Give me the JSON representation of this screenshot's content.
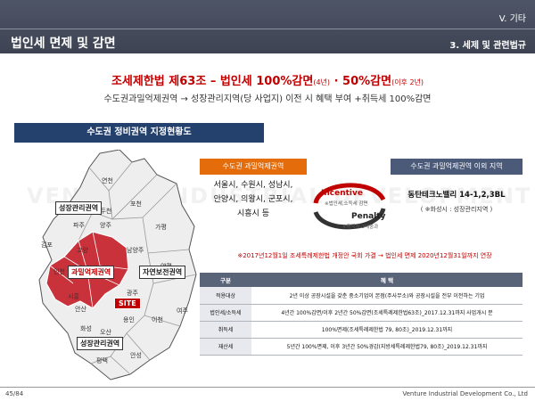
{
  "header": {
    "section": "V. 기타",
    "title": "법인세 면제 및 감면",
    "subtitle": "3. 세제 및 관련법규"
  },
  "headline": {
    "part1": "조세제한법 제63조 – 법인세 100%감면",
    "small1": "(4년)",
    "part2": " · 50%감면",
    "small2": "(이후 2년)"
  },
  "subline": "수도권과밀억제권역 → 성장관리지역(당 사업지) 이전 시 혜택 부여 +취득세 100%감면",
  "map": {
    "banner": "수도권 정비권역 지정현황도",
    "tags": {
      "growth_top": "성장관리권역",
      "overcrowded": "과밀억제권역",
      "conservation": "자연보전권역",
      "growth_bottom": "성장관리권역",
      "site": "SITE"
    },
    "places": [
      "연천",
      "포천",
      "파주",
      "양주",
      "동두천",
      "가평",
      "김포",
      "고양",
      "남양주",
      "양평",
      "인천",
      "시흥",
      "안산",
      "화성",
      "오산",
      "용인",
      "이천",
      "여주",
      "평택",
      "안성",
      "광주"
    ]
  },
  "left_panel": {
    "header": "수도권 과밀억제권역",
    "lines": [
      "서울시, 수원시, 성남시,",
      "안양시, 의왕시, 군포시,",
      "시흥시 등"
    ]
  },
  "right_panel": {
    "header": "수도권 과밀억제권역 이외 지역",
    "main": "동탄테크노밸리 14-1,2,3BL",
    "note": "( ※화성시 : 성장관리지역 )"
  },
  "cycle": {
    "incentive": "Incentive",
    "incentive_note": "※법인세,소득세 감면",
    "penalty": "Penalty",
    "penalty_note": "※취득세 3배중과"
  },
  "notice": "※2017년12월1일 조세특례제한법 개정안 국회 가결 → 법인세 면제 2020년12월31일까지 연장",
  "table": {
    "headers": [
      "구분",
      "혜 택"
    ],
    "rows": [
      {
        "cat": "적용대상",
        "text": "2년 이상 공장시설을 갖춘 중소기업이 본점(주사무소)와 공장시설을 전부 이전하는 기업"
      },
      {
        "cat": "법인세/소득세",
        "text": "4년간 100%감면/이후 2년간 50%감면(조세특례제한법63조)_2017.12.31까지 사업개시 분"
      },
      {
        "cat": "취득세",
        "text": "100%면제(조세특례제한법 79, 80조)_2019.12.31까지"
      },
      {
        "cat": "재산세",
        "text": "5년간 100%면제, 이후 3년간 50%경감(지방세특례제한법79, 80조)_2019.12.31까지"
      }
    ]
  },
  "footer": {
    "page": "45/84",
    "company": "Venture Industrial Development Co., Ltd"
  },
  "watermark": "VENTURE INDUSTRIAL DEVELOPMENT",
  "colors": {
    "header_bg": "#4e5567",
    "accent_red": "#c00000",
    "orange": "#e46c0a",
    "navy": "#24416e",
    "map_overcrowded": "#c9323a"
  }
}
